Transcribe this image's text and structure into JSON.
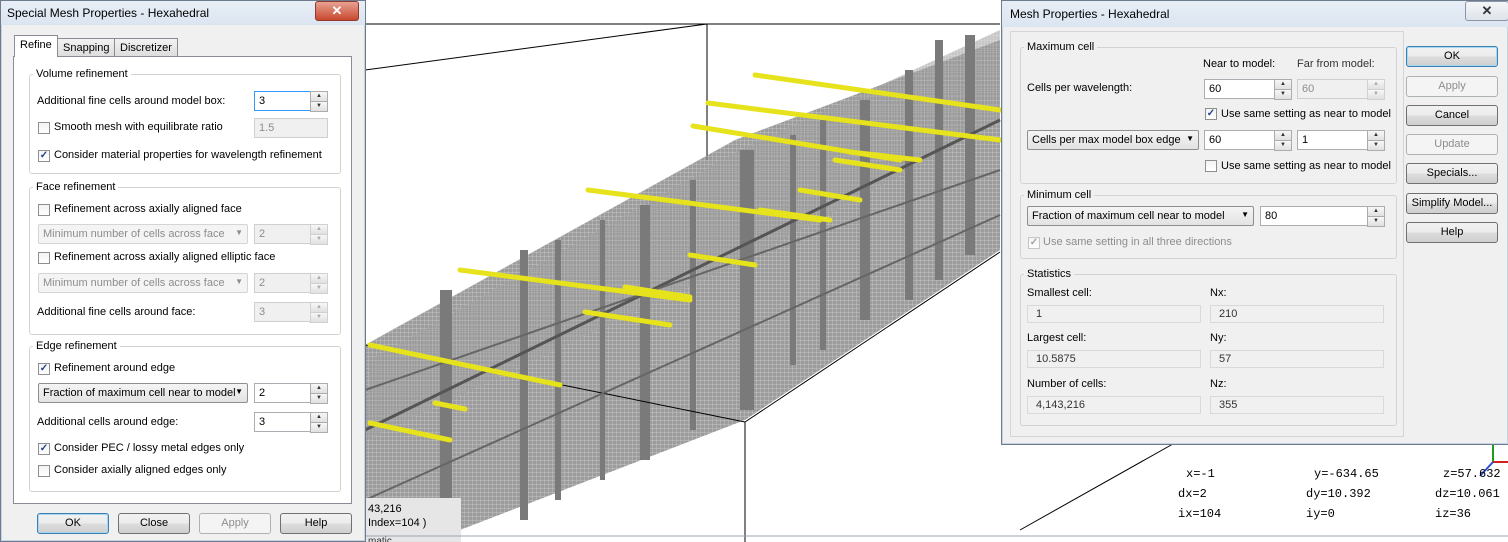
{
  "left_dialog": {
    "title": "Special Mesh Properties - Hexahedral",
    "close_symbol": "✕",
    "tabs": [
      "Refine",
      "Snapping",
      "Discretizer"
    ],
    "volume": {
      "group": "Volume refinement",
      "additional_label": "Additional fine cells around model box:",
      "additional_value": "3",
      "smooth_label": "Smooth mesh with equilibrate ratio",
      "smooth_value": "1.5",
      "material_label": "Consider material properties for wavelength refinement"
    },
    "face": {
      "group": "Face refinement",
      "across_label": "Refinement across axially aligned face",
      "combo1": "Minimum number of cells across face",
      "combo1_value": "2",
      "elliptic_label": "Refinement across axially aligned elliptic face",
      "combo2": "Minimum number of cells across face",
      "combo2_value": "2",
      "additional_label": "Additional fine cells around face:",
      "additional_value": "3"
    },
    "edge": {
      "group": "Edge refinement",
      "around_label": "Refinement around edge",
      "combo": "Fraction of maximum cell near to model",
      "combo_value": "2",
      "additional_label": "Additional cells around edge:",
      "additional_value": "3",
      "pec_label": "Consider PEC / lossy metal edges only",
      "axially_label": "Consider axially aligned edges only"
    },
    "buttons": {
      "ok": "OK",
      "close": "Close",
      "apply": "Apply",
      "help": "Help"
    }
  },
  "right_dialog": {
    "title": "Mesh Properties - Hexahedral",
    "close_symbol": "✕",
    "maximum": {
      "group": "Maximum cell",
      "near_label": "Near to model:",
      "far_label": "Far from model:",
      "cpw_label": "Cells per wavelength:",
      "cpw_near": "60",
      "cpw_far": "60",
      "same1_label": "Use same setting as near to model",
      "combo": "Cells per max model box edge",
      "edge_near": "60",
      "edge_far": "1",
      "same2_label": "Use same setting as near to model"
    },
    "minimum": {
      "group": "Minimum cell",
      "combo": "Fraction of maximum cell near to model",
      "value": "80",
      "same_label": "Use same setting in all three directions"
    },
    "statistics": {
      "group": "Statistics",
      "smallest_label": "Smallest cell:",
      "smallest": "1",
      "nx_label": "Nx:",
      "nx": "210",
      "largest_label": "Largest cell:",
      "largest": "10.5875",
      "ny_label": "Ny:",
      "ny": "57",
      "number_label": "Number of cells:",
      "number": "4,143,216",
      "nz_label": "Nz:",
      "nz": "355"
    },
    "buttons": {
      "ok": "OK",
      "apply": "Apply",
      "cancel": "Cancel",
      "update": "Update",
      "specials": "Specials...",
      "simplify": "Simplify Model...",
      "help": "Help"
    }
  },
  "viewport": {
    "status_cells": "43,216",
    "status_index": "Index=104 )",
    "bottom_text": "matic"
  },
  "coords": {
    "x": "x=-1",
    "y": "y=-634.65",
    "z": "z=57.632",
    "dx": "dx=2",
    "dy": "dy=10.392",
    "dz": "dz=10.061",
    "ix": "ix=104",
    "iy": "iy=0",
    "iz": "iz=36"
  },
  "colors": {
    "mesh_gray": "#8e8e8e",
    "wire_yellow": "#e6e21c",
    "dialog_bg": "#f0f0f0"
  },
  "icons": [
    "check-icon",
    "spin-up-icon",
    "spin-down-icon",
    "dropdown-arrow-icon",
    "close-icon",
    "axis-triad-icon"
  ]
}
